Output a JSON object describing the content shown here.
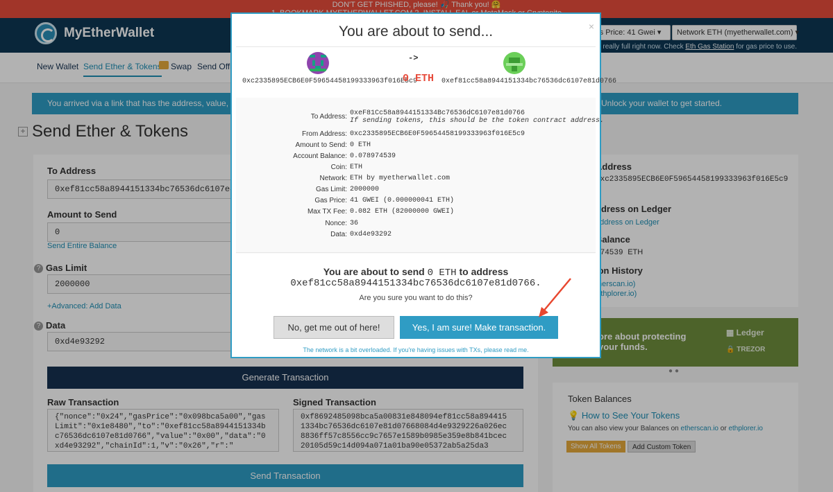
{
  "warning": {
    "line1": "DON'T GET PHISHED, please! 🎣 Thank you! 🤗",
    "line2": "1. BOOKMARK MYETHERWALLET.COM       2. INSTALL EAL or MetaMask or Cryptonite"
  },
  "header": {
    "logo_text": "MyEtherWallet",
    "gas_price": "Gas Price: 41 Gwei",
    "network": "Network ETH (myetherwallet.com)",
    "note_pre": "etwork is really full right now. Check ",
    "note_link": "Eth Gas Station",
    "note_post": " for gas price to use."
  },
  "nav": {
    "items": [
      {
        "label": "New Wallet"
      },
      {
        "label": "Send Ether & Tokens"
      },
      {
        "label": "Swap"
      },
      {
        "label": "Send Offli"
      }
    ]
  },
  "info": {
    "left": "You arrived via a link that has the address, value, gas,",
    "right": "Unlock your wallet to get started."
  },
  "page": {
    "title": "Send Ether & Tokens",
    "expand": "+"
  },
  "form": {
    "to_label": "To Address",
    "to_value": "0xef81cc58a8944151334bc76536dc6107e81d0766",
    "amount_label": "Amount to Send",
    "amount_value": "0",
    "send_entire": "Send Entire Balance",
    "gas_label": "Gas Limit",
    "gas_value": "2000000",
    "advanced": "+Advanced: Add Data",
    "data_label": "Data",
    "data_value": "0xd4e93292",
    "help": "?",
    "generate": "Generate Transaction",
    "raw_label": "Raw Transaction",
    "raw_value": "{\"nonce\":\"0x24\",\"gasPrice\":\"0x098bca5a00\",\"gasLimit\":\"0x1e8480\",\"to\":\"0xef81cc58a8944151334bc76536dc6107e81d0766\",\"value\":\"0x00\",\"data\":\"0xd4e93292\",\"chainId\":1,\"v\":\"0x26\",\"r\":\"",
    "signed_label": "Signed Transaction",
    "signed_value": "0xf8692485098bca5a00831e848094ef81cc58a8944151334bc76536dc6107e81d07668084d4e9329226a026ec8836ff57c8556cc9c7657e1589b0985e359e8b841bcec20105d59c14d094a071a01ba90e05372ab5a25da3",
    "send": "Send Transaction"
  },
  "side": {
    "address_title": "Address",
    "address_value": "0xc2335895ECB6E0F59654458199333963f016E5c9",
    "ledger_title": "ddress on Ledger",
    "ledger_link": "address on Ledger",
    "balance_title": "Balance",
    "balance_value": "974539",
    "balance_unit": "ETH",
    "history_title": "ion History",
    "etherscan": "therscan.io)",
    "ethplorer": "Ethplorer.io)"
  },
  "promo": {
    "line1": "ore about protecting",
    "line2": "your funds.",
    "brand1": "Ledger",
    "brand2": "TREZOR"
  },
  "tokens": {
    "title": "Token Balances",
    "howto": "How to See Your Tokens",
    "also_pre": "You can also view your Balances on ",
    "also_link1": "etherscan.io",
    "also_mid": " or ",
    "also_link2": "ethplorer.io",
    "show_all": "Show All Tokens",
    "add_custom": "Add Custom Token"
  },
  "modal": {
    "title": "You are about to send...",
    "close": "×",
    "from_addr": "0xc2335895ECB6E0F59654458199333963f016E5c9",
    "to_addr": "0xef81cc58a8944151334bc76536dc6107e81d0766",
    "arrow": "->",
    "amount": "0 ETH",
    "details": [
      {
        "key": "To Address:",
        "value": "0xeF81Cc58a8944151334Bc76536dC6107e81d0766",
        "hint": "If sending tokens, this should be the token contract address."
      },
      {
        "key": "From Address:",
        "value": "0xc2335895ECB6E0F59654458199333963f016E5c9"
      },
      {
        "key": "Amount to Send:",
        "value": "0 ETH"
      },
      {
        "key": "Account Balance:",
        "value": "0.078974539"
      },
      {
        "key": "Coin:",
        "value": "ETH"
      },
      {
        "key": "Network:",
        "value": "ETH by myetherwallet.com"
      },
      {
        "key": "Gas Limit:",
        "value": "2000000"
      },
      {
        "key": "Gas Price:",
        "value": "41 GWEI (0.000000041 ETH)"
      },
      {
        "key": "Max TX Fee:",
        "value": "0.082 ETH (82000000 GWEI)"
      },
      {
        "key": "Nonce:",
        "value": "36"
      },
      {
        "key": "Data:",
        "value": "0xd4e93292"
      }
    ],
    "confirm_pre": "You are about to send",
    "confirm_amount": "0 ETH",
    "confirm_post": "to address",
    "confirm_addr": "0xef81cc58a8944151334bc76536dc6107e81d0766.",
    "confirm_q": "Are you sure you want to do this?",
    "no_btn": "No, get me out of here!",
    "yes_btn": "Yes, I am sure! Make transaction.",
    "footer": "The network is a bit overloaded. If you're having issues with TXs, please read me."
  },
  "colors": {
    "header": "#0e3754",
    "accent": "#2f9cc4",
    "warning": "#e74c3c",
    "promo": "#6f8e3d"
  }
}
